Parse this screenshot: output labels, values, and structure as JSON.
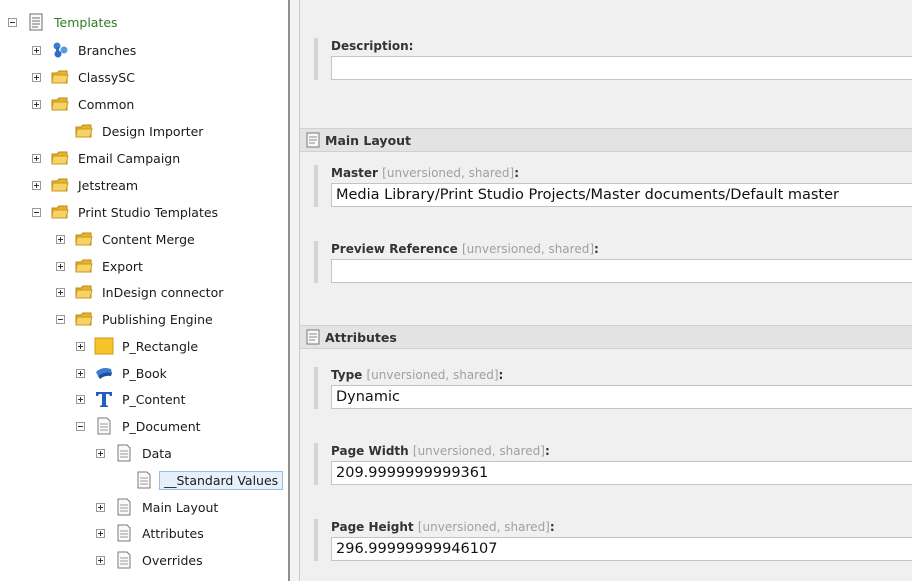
{
  "tree": {
    "items": [
      {
        "label": "Templates",
        "toggle": "minus",
        "icon": "template-icon",
        "root": true
      },
      {
        "label": "Branches",
        "toggle": "plus",
        "icon": "branches-icon"
      },
      {
        "label": "ClassySC",
        "toggle": "plus",
        "icon": "folder-icon"
      },
      {
        "label": "Common",
        "toggle": "plus",
        "icon": "folder-icon"
      },
      {
        "label": "Design Importer",
        "toggle": "none",
        "icon": "folder-icon"
      },
      {
        "label": "Email Campaign",
        "toggle": "plus",
        "icon": "folder-icon"
      },
      {
        "label": "Jetstream",
        "toggle": "plus",
        "icon": "folder-icon"
      },
      {
        "label": "Print Studio Templates",
        "toggle": "minus",
        "icon": "folder-icon"
      },
      {
        "label": "Content Merge",
        "toggle": "plus",
        "icon": "folder-icon"
      },
      {
        "label": "Export",
        "toggle": "plus",
        "icon": "folder-icon"
      },
      {
        "label": "InDesign connector",
        "toggle": "plus",
        "icon": "folder-icon"
      },
      {
        "label": "Publishing Engine",
        "toggle": "minus",
        "icon": "folder-icon"
      },
      {
        "label": "P_Rectangle",
        "toggle": "plus",
        "icon": "rectangle-icon"
      },
      {
        "label": "P_Book",
        "toggle": "plus",
        "icon": "book-icon"
      },
      {
        "label": "P_Content",
        "toggle": "plus",
        "icon": "text-icon"
      },
      {
        "label": "P_Document",
        "toggle": "minus",
        "icon": "document-icon"
      },
      {
        "label": "Data",
        "toggle": "plus",
        "icon": "document-icon"
      },
      {
        "label": "__Standard Values",
        "toggle": "none",
        "icon": "document-icon",
        "selected": true
      },
      {
        "label": "Main Layout",
        "toggle": "plus",
        "icon": "document-icon"
      },
      {
        "label": "Attributes",
        "toggle": "plus",
        "icon": "document-icon"
      },
      {
        "label": "Overrides",
        "toggle": "plus",
        "icon": "document-icon"
      }
    ]
  },
  "editor": {
    "description": {
      "label": "Description:",
      "value": ""
    },
    "sections": {
      "main_layout": {
        "title": "Main Layout",
        "icon": "section-icon"
      },
      "attributes": {
        "title": "Attributes",
        "icon": "section-icon"
      }
    },
    "fields": {
      "master": {
        "label": "Master",
        "note": "[unversioned, shared]",
        "colon": ":",
        "value": "Media Library/Print Studio Projects/Master documents/Default master"
      },
      "preview_reference": {
        "label": "Preview Reference",
        "note": "[unversioned, shared]",
        "colon": ":",
        "value": ""
      },
      "type": {
        "label": "Type",
        "note": "[unversioned, shared]",
        "colon": ":",
        "value": "Dynamic"
      },
      "page_width": {
        "label": "Page Width",
        "note": "[unversioned, shared]",
        "colon": ":",
        "value": "209.9999999999361"
      },
      "page_height": {
        "label": "Page Height",
        "note": "[unversioned, shared]",
        "colon": ":",
        "value": "296.99999999946107"
      }
    }
  },
  "colors": {
    "folder": "#f2c33a",
    "root_label": "#2f7d21",
    "selection": "#e6f0fb",
    "section_header": "#e3e3e3",
    "editor_bg": "#f0f0f0"
  }
}
